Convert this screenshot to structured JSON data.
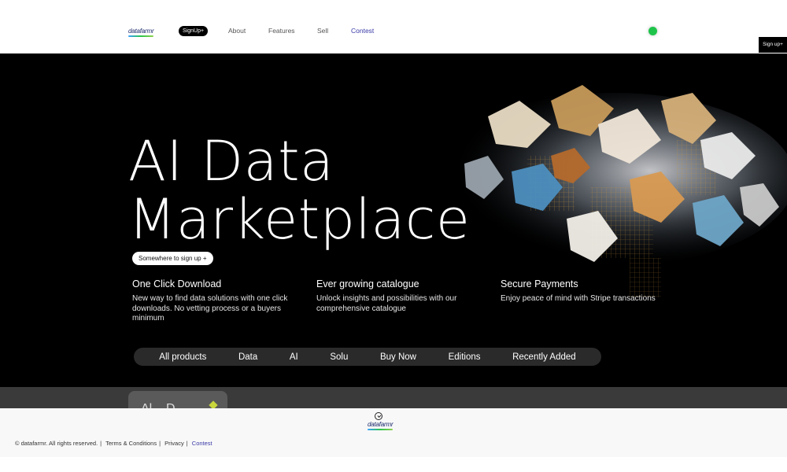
{
  "header": {
    "logo_text": "datafarmr",
    "signup_pill": "SignUp+",
    "nav": [
      "About",
      "Features",
      "Sell",
      "Contest"
    ],
    "side_signup": "Sign up+"
  },
  "hero": {
    "title_line1": "AI Data",
    "title_line2": "Marketplace",
    "cta": "Somewhere to sign up +",
    "features": [
      {
        "title": "One Click Download",
        "text": "New way to find data solutions with one click downloads. No vetting process or a buyers minimum"
      },
      {
        "title": "Ever growing catalogue",
        "text": "Unlock insights and possibilities with our comprehensive catalogue"
      },
      {
        "title": "Secure Payments",
        "text": "Enjoy peace of mind with Stripe transactions"
      }
    ],
    "tabs": [
      "All products",
      "Data",
      "AI",
      "Solu",
      "Buy Now",
      "Editions",
      "Recently Added"
    ]
  },
  "strip": {
    "card_text": "Al... D"
  },
  "footer": {
    "logo_text": "datafarmr",
    "copyright": "© datafarmr. All rights reserved.",
    "links": [
      "Terms & Conditions",
      "Privacy",
      "Contest"
    ]
  },
  "colors": {
    "accent": "#3a3aa8",
    "status": "#1ec44a",
    "hero_bg": "#000000"
  },
  "icons": {
    "status": "status-dot-icon",
    "footer_clock": "clock-icon"
  }
}
